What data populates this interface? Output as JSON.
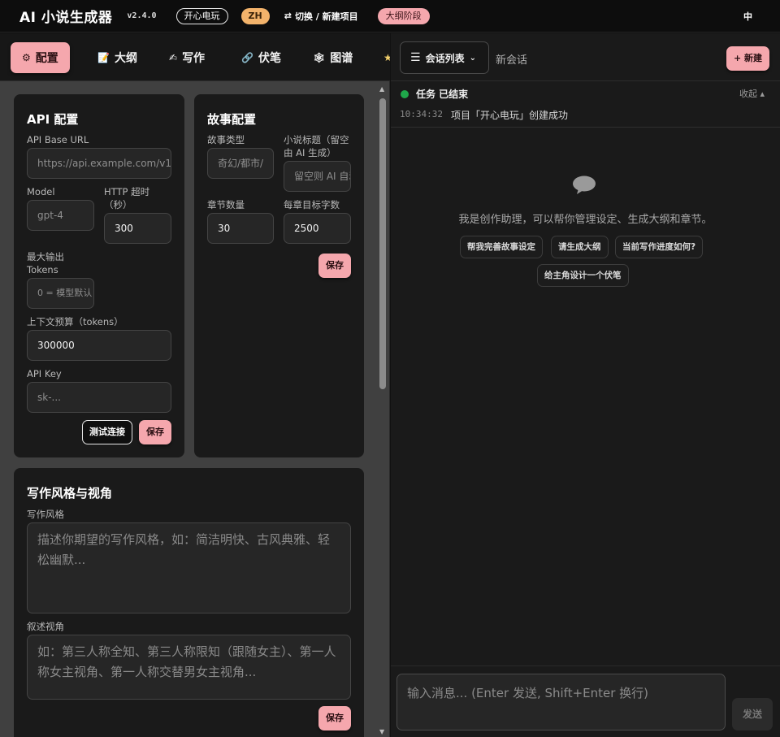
{
  "app": {
    "title": "AI 小说生成器",
    "version": "v2.4.0",
    "project": "开心电玩",
    "lang_code": "ZH",
    "switch_label": "切换 / 新建项目",
    "stage": "大纲阶段",
    "ui_lang": "中"
  },
  "tabs": [
    {
      "icon": "⚙",
      "label": "配置"
    },
    {
      "icon": "📝",
      "label": "大纲"
    },
    {
      "icon": "✍",
      "label": "写作"
    },
    {
      "icon": "🔗",
      "label": "伏笔"
    },
    {
      "icon": "🕸",
      "label": "图谱"
    },
    {
      "icon": "★",
      "label": ""
    }
  ],
  "api_config": {
    "title": "API 配置",
    "base_url_label": "API Base URL",
    "base_url_placeholder": "https://api.example.com/v1",
    "model_label": "Model",
    "model_placeholder": "gpt-4",
    "timeout_label": "HTTP 超时（秒）",
    "timeout_value": "300",
    "max_tokens_label": "最大输出 Tokens",
    "max_tokens_placeholder": "0 = 模型默认",
    "context_label": "上下文预算（tokens）",
    "context_value": "300000",
    "api_key_label": "API Key",
    "api_key_placeholder": "sk-...",
    "test_button": "测试连接",
    "save_button": "保存"
  },
  "story_config": {
    "title": "故事配置",
    "genre_label": "故事类型",
    "genre_placeholder": "奇幻/都市/",
    "novel_title_label": "小说标题（留空由 AI 生成）",
    "novel_title_placeholder": "留空则 AI 自动生成",
    "chapters_label": "章节数量",
    "chapters_value": "30",
    "words_label": "每章目标字数",
    "words_value": "2500",
    "save_button": "保存"
  },
  "style_config": {
    "title": "写作风格与视角",
    "style_label": "写作风格",
    "style_placeholder": "描述你期望的写作风格，如：简洁明快、古风典雅、轻松幽默...",
    "pov_label": "叙述视角",
    "pov_placeholder": "如：第三人称全知、第三人称限知（跟随女主）、第一人称女主视角、第一人称交替男女主视角...",
    "save_button": "保存"
  },
  "chat": {
    "session_list": "会话列表",
    "new_session_label": "新会话",
    "new_button": "+ 新建",
    "task_status": "任务 已结束",
    "collapse": "收起 ▴",
    "log_time": "10:34:32",
    "log_message": "项目「开心电玩」创建成功",
    "assistant_intro": "我是创作助理，可以帮你管理设定、生成大纲和章节。",
    "suggestions": [
      "帮我完善故事设定",
      "请生成大纲",
      "当前写作进度如何?",
      "给主角设计一个伏笔"
    ],
    "input_placeholder": "输入消息... (Enter 发送, Shift+Enter 换行)",
    "send_button": "发送"
  },
  "colors": {
    "accent_pink": "#f5a7ad",
    "lang_orange": "#f3b36b",
    "status_green": "#1fa84a"
  }
}
